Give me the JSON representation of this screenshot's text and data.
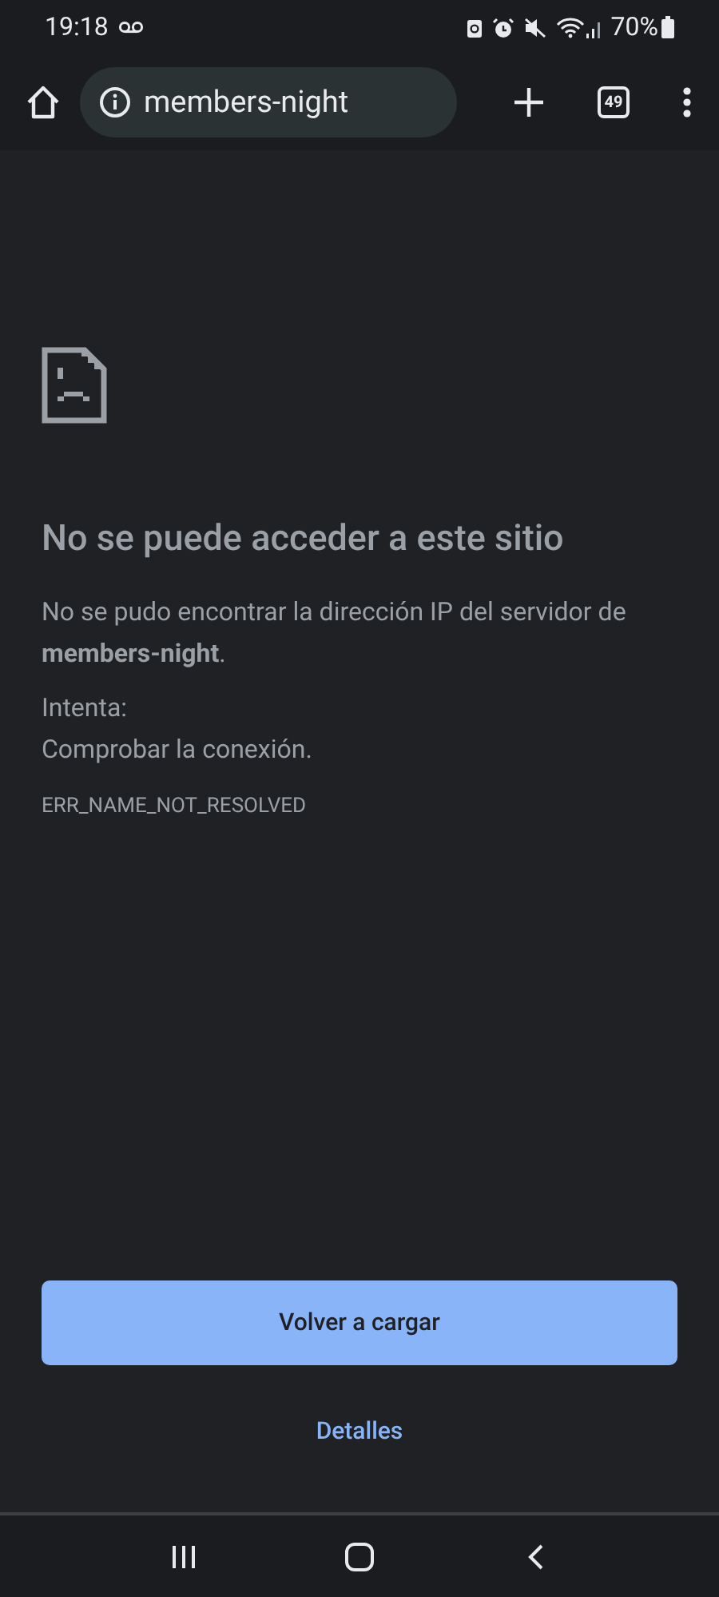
{
  "status_bar": {
    "time": "19:18",
    "battery": "70%"
  },
  "toolbar": {
    "url": "members-night",
    "tab_count": "49"
  },
  "error": {
    "title": "No se puede acceder a este sitio",
    "message": "No se pudo encontrar la dirección IP del servidor de **members-night**.",
    "try_label": "Intenta:",
    "suggestion": "Comprobar la conexión.",
    "code": "ERR_NAME_NOT_RESOLVED"
  },
  "buttons": {
    "reload": "Volver a cargar",
    "details": "Detalles"
  }
}
